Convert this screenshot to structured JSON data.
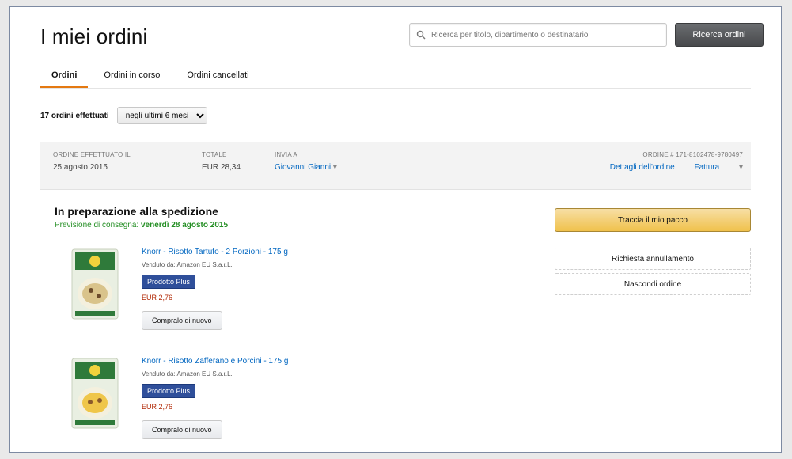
{
  "page": {
    "title": "I miei ordini"
  },
  "search": {
    "placeholder": "Ricerca per titolo, dipartimento o destinatario",
    "button_label": "Ricerca ordini"
  },
  "tabs": [
    {
      "label": "Ordini",
      "active": true
    },
    {
      "label": "Ordini in corso",
      "active": false
    },
    {
      "label": "Ordini cancellati",
      "active": false
    }
  ],
  "summary": {
    "count_text": "17 ordini effettuati",
    "period_selected": "negli ultimi 6 mesi"
  },
  "order": {
    "placed_label": "ORDINE EFFETTUATO IL",
    "placed_value": "25 agosto 2015",
    "total_label": "TOTALE",
    "total_value": "EUR 28,34",
    "ship_label": "INVIA A",
    "ship_value": "Giovanni Gianni",
    "order_number_label": "ORDINE # 171-8102478-9780497",
    "details_link": "Dettagli dell'ordine",
    "invoice_link": "Fattura",
    "status_title": "In preparazione alla spedizione",
    "delivery_prefix": "Previsione di consegna:",
    "delivery_date": "venerdì 28 agosto 2015"
  },
  "items": [
    {
      "title": "Knorr - Risotto Tartufo - 2 Porzioni - 175 g",
      "seller": "Venduto da: Amazon EU S.a.r.L.",
      "badge": "Prodotto Plus",
      "price": "EUR 2,76",
      "buy_again": "Compralo di nuovo"
    },
    {
      "title": "Knorr - Risotto Zafferano e Porcini - 175 g",
      "seller": "Venduto da: Amazon EU S.a.r.L.",
      "badge": "Prodotto Plus",
      "price": "EUR 2,76",
      "buy_again": "Compralo di nuovo"
    }
  ],
  "actions": {
    "track_label": "Traccia il mio pacco",
    "cancel_label": "Richiesta annullamento",
    "hide_label": "Nascondi ordine"
  },
  "colors": {
    "accent_tab": "#e47911",
    "link": "#0066c0",
    "delivery_green": "#238e23",
    "price": "#b12704",
    "track_button": "#f0c14b",
    "badge": "#2f4f9a"
  }
}
